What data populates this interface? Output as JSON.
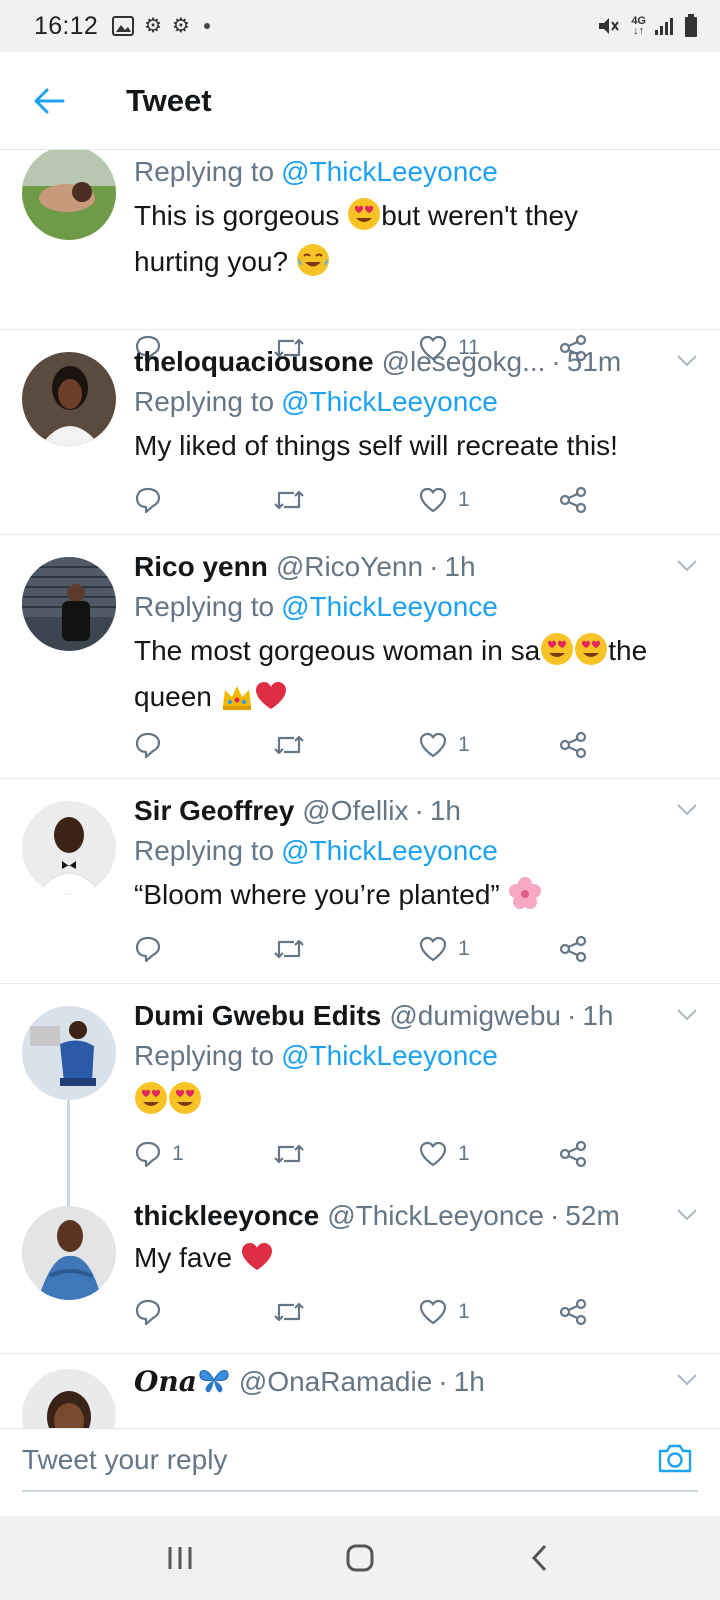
{
  "status_bar": {
    "time": "16:12",
    "left_icons": [
      "image-icon",
      "gear-icon",
      "gear-icon",
      "dot-icon"
    ],
    "network": "4G",
    "right_icons": [
      "mute-vibrate-icon",
      "network-4g-icon",
      "signal-icon",
      "battery-icon"
    ]
  },
  "header": {
    "title": "Tweet"
  },
  "colors": {
    "accent": "#1da1f2",
    "secondary_text": "#657786",
    "heart": "#e0245e"
  },
  "replying_prefix": "Replying to",
  "tweets": [
    {
      "name": "",
      "handle": "",
      "time": "",
      "replying_to": "@ThickLeeyonce",
      "text_a": "This is gorgeous ",
      "text_b": "but weren't they",
      "text_c": "hurting you? ",
      "counts": {
        "reply": "",
        "retweet": "",
        "like": "11"
      }
    },
    {
      "name": "theloquaciousone",
      "handle": "@lesegokg...",
      "time": "51m",
      "replying_to": "@ThickLeeyonce",
      "text": "My liked of things self will recreate this!",
      "counts": {
        "reply": "",
        "retweet": "",
        "like": "1"
      }
    },
    {
      "name": "Rico yenn",
      "handle": "@RicoYenn",
      "time": "1h",
      "replying_to": "@ThickLeeyonce",
      "text_a": "The most gorgeous woman in sa",
      "text_b": "the",
      "text_c": "queen ",
      "counts": {
        "reply": "",
        "retweet": "",
        "like": "1"
      }
    },
    {
      "name": "Sir Geoffrey",
      "handle": "@Ofellix",
      "time": "1h",
      "replying_to": "@ThickLeeyonce",
      "text": "“Bloom where you’re planted” ",
      "counts": {
        "reply": "",
        "retweet": "",
        "like": "1"
      }
    },
    {
      "name": "Dumi Gwebu Edits",
      "handle": "@dumigwebu",
      "time": "1h",
      "replying_to": "@ThickLeeyonce",
      "text": "",
      "counts": {
        "reply": "1",
        "retweet": "",
        "like": "1"
      }
    },
    {
      "name": "thickleeyonce",
      "handle": "@ThickLeeyonce",
      "time": "52m",
      "text": "My fave ",
      "counts": {
        "reply": "",
        "retweet": "",
        "like": "1"
      }
    },
    {
      "name": "Ona",
      "handle": "@OnaRamadie",
      "time": "1h"
    }
  ],
  "reply_bar": {
    "placeholder": "Tweet your reply"
  },
  "nav": [
    "recents-button",
    "home-button",
    "back-button"
  ]
}
